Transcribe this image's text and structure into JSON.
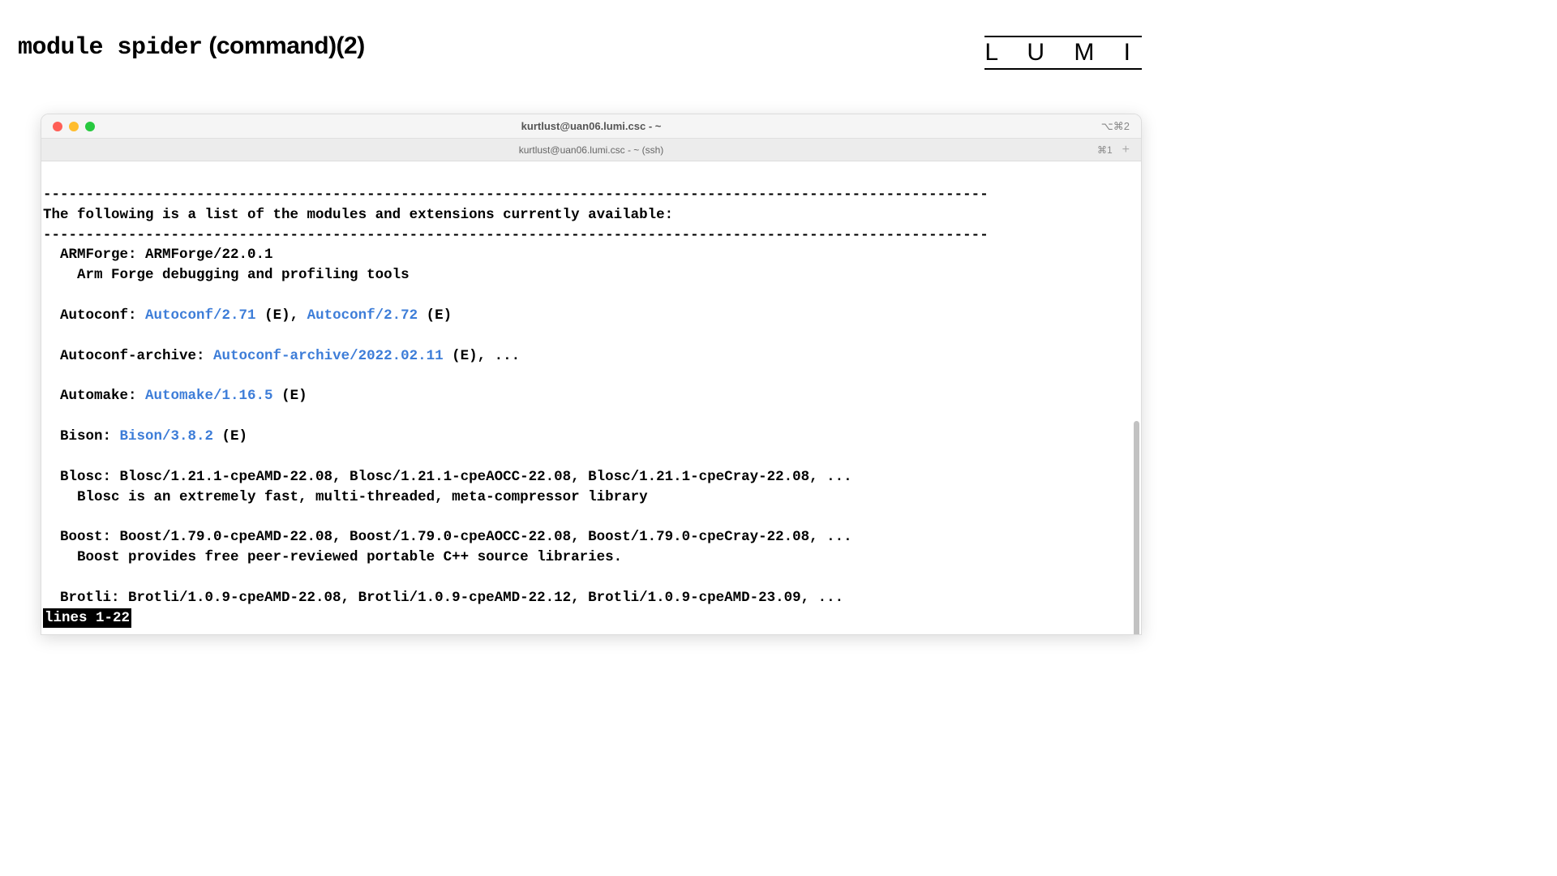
{
  "slide": {
    "title_cmd": "module spider",
    "title_suffix": " (command)(2)",
    "logo": "L U M I"
  },
  "window": {
    "title": "kurtlust@uan06.lumi.csc - ~",
    "title_shortcut": "⌥⌘2",
    "tab_title": "kurtlust@uan06.lumi.csc - ~ (ssh)",
    "tab_shortcut": "⌘1"
  },
  "terminal": {
    "divider": "---------------------------------------------------------------------------------------------------------------",
    "header_line": "The following is a list of the modules and extensions currently available:",
    "modules": {
      "armforge": {
        "label": "  ARMForge: ARMForge/22.0.1",
        "desc": "    Arm Forge debugging and profiling tools"
      },
      "autoconf": {
        "prefix": "  Autoconf: ",
        "v1": "Autoconf/2.71",
        "mid": " (E), ",
        "v2": "Autoconf/2.72",
        "suffix": " (E)"
      },
      "autoconf_archive": {
        "prefix": "  Autoconf-archive: ",
        "v1": "Autoconf-archive/2022.02.11",
        "suffix": " (E), ..."
      },
      "automake": {
        "prefix": "  Automake: ",
        "v1": "Automake/1.16.5",
        "suffix": " (E)"
      },
      "bison": {
        "prefix": "  Bison: ",
        "v1": "Bison/3.8.2",
        "suffix": " (E)"
      },
      "blosc": {
        "line": "  Blosc: Blosc/1.21.1-cpeAMD-22.08, Blosc/1.21.1-cpeAOCC-22.08, Blosc/1.21.1-cpeCray-22.08, ...",
        "desc": "    Blosc is an extremely fast, multi-threaded, meta-compressor library"
      },
      "boost": {
        "line": "  Boost: Boost/1.79.0-cpeAMD-22.08, Boost/1.79.0-cpeAOCC-22.08, Boost/1.79.0-cpeCray-22.08, ...",
        "desc": "    Boost provides free peer-reviewed portable C++ source libraries."
      },
      "brotli": {
        "line": "  Brotli: Brotli/1.0.9-cpeAMD-22.08, Brotli/1.0.9-cpeAMD-22.12, Brotli/1.0.9-cpeAMD-23.09, ..."
      }
    },
    "pager": "lines 1-22"
  }
}
